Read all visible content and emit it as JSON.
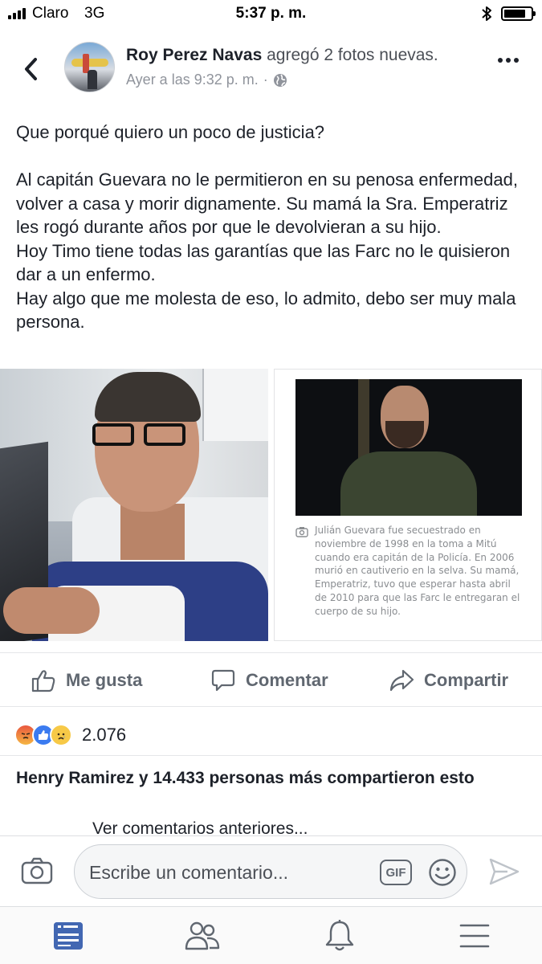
{
  "status_bar": {
    "carrier": "Claro",
    "network": "3G",
    "time": "5:37 p. m."
  },
  "post": {
    "author": "Roy Perez Navas",
    "action": "agregó 2 fotos nuevas.",
    "timestamp": "Ayer a las 9:32 p. m.",
    "separator": "·",
    "text": [
      "Que porqué quiero un poco de justicia?",
      "",
      "Al capitán Guevara no le permitieron en su penosa enfermedad, volver a casa y morir dignamente. Su mamá la Sra. Emperatriz les rogó durante años por que le devolvieran a su hijo.",
      "Hoy Timo tiene todas las garantías que las Farc no le quisieron dar a un enfermo.",
      "Hay algo que me molesta de eso, lo admito, debo ser muy mala persona."
    ],
    "photo_caption": "Julián Guevara fue secuestrado en noviembre de 1998 en la toma a Mitú cuando era capitán de la Policía. En 2006 murió en cautiverio en la selva. Su mamá, Emperatriz, tuvo que esperar hasta abril de 2010 para que las Farc le entregaran el cuerpo de su hijo."
  },
  "actions": {
    "like": "Me gusta",
    "comment": "Comentar",
    "share": "Compartir"
  },
  "reactions": {
    "types": [
      "angry",
      "like",
      "sad"
    ],
    "count": "2.076"
  },
  "shares_text": "Henry Ramirez y 14.433 personas más compartieron esto",
  "previous_comments": "Ver comentarios anteriores...",
  "composer": {
    "placeholder": "Escribe un comentario...",
    "gif_label": "GIF"
  },
  "tabs": [
    "news-feed",
    "friends",
    "notifications",
    "menu"
  ],
  "colors": {
    "accent": "#4267b2",
    "text": "#1d2129",
    "secondary_text": "#90949c",
    "action_text": "#606770"
  }
}
